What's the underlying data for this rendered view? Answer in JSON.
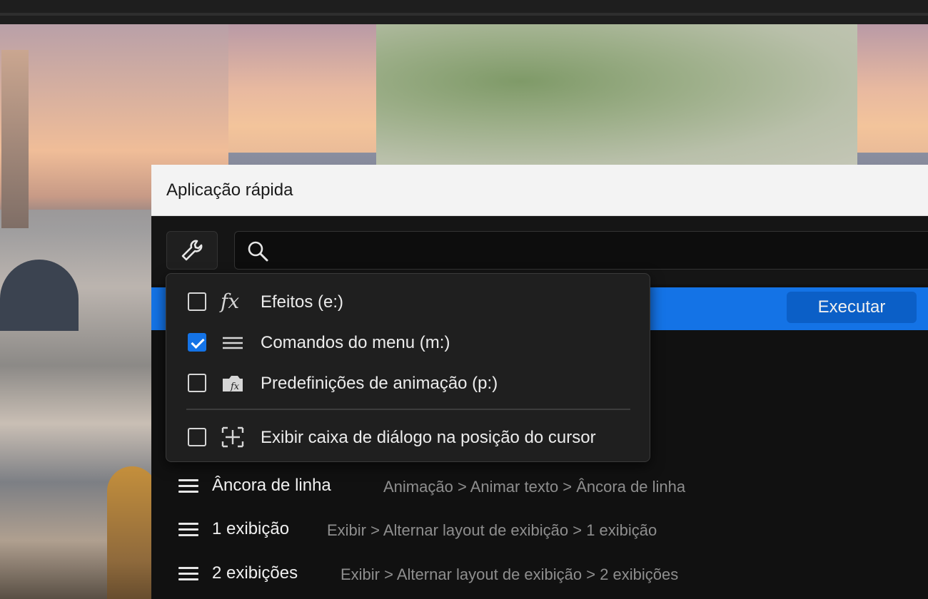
{
  "dialog": {
    "title": "Aplicação rápida",
    "search": {
      "value": "",
      "placeholder": ""
    },
    "run_button": "Executar",
    "icons": {
      "tools": "wrench-icon",
      "search": "search-icon"
    }
  },
  "filter_menu": {
    "items": [
      {
        "label": "Efeitos (e:)",
        "checked": false,
        "icon": "fx-icon"
      },
      {
        "label": "Comandos do menu (m:)",
        "checked": true,
        "icon": "menu-lines-icon"
      },
      {
        "label": "Predefinições de animação (p:)",
        "checked": false,
        "icon": "animation-preset-icon"
      },
      {
        "label": "Exibir caixa de diálogo na posição do cursor",
        "checked": false,
        "icon": "cursor-position-icon"
      }
    ]
  },
  "results": [
    {
      "name": "Âncora de linha",
      "path": "Animação > Animar texto > Âncora de linha"
    },
    {
      "name": "1 exibição",
      "path": "Exibir > Alternar layout de exibição > 1 exibição"
    },
    {
      "name": "2 exibições",
      "path": "Exibir > Alternar layout de exibição > 2 exibições"
    }
  ],
  "colors": {
    "accent": "#1473e6",
    "run_button": "#0b5fc7",
    "dialog_bg": "#111111",
    "popover_bg": "#1f1f1f",
    "title_bar": "#f3f3f3"
  }
}
